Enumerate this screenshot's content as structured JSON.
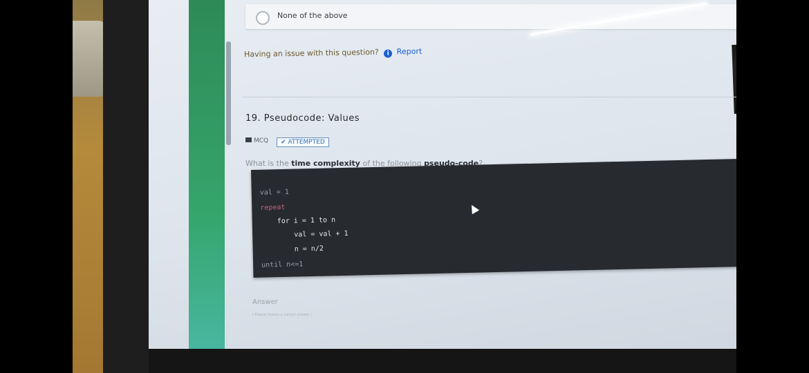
{
  "option": {
    "label": "None of the above"
  },
  "issue": {
    "text": "Having an issue with this question?",
    "info_icon_char": "i",
    "report_label": "Report"
  },
  "question": {
    "number_title": "19. Pseudocode: Values",
    "type_badge": "MCQ",
    "status_badge": "✔ ATTEMPTED",
    "prompt_prefix": "What is the ",
    "prompt_bold1": "time complexity",
    "prompt_middle": " of the following ",
    "prompt_bold2": "pseudo-code",
    "prompt_suffix": "?"
  },
  "code_lines": [
    "val = 1",
    "repeat",
    "    for i = 1 to n",
    "        val = val + 1",
    "        n = n/2",
    "until n<=1"
  ],
  "answer": {
    "label": "Answer",
    "hint": "( Please choose a correct answer )"
  },
  "colors": {
    "accent_blue": "#1a5fd1",
    "sidebar_green": "#2e8a58",
    "code_bg": "#272a2f"
  }
}
